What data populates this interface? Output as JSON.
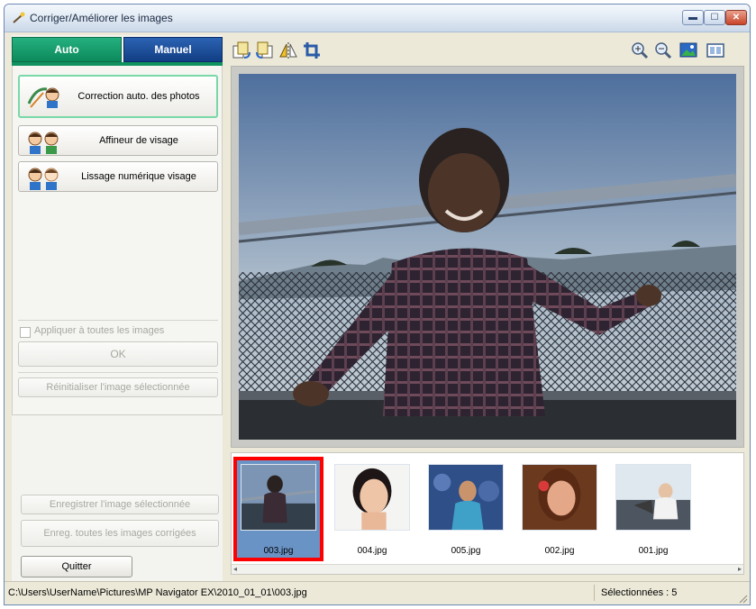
{
  "window": {
    "title": "Corriger/Améliorer les images",
    "title_icon": "wand-icon"
  },
  "tabs": [
    {
      "label": "Auto"
    },
    {
      "label": "Manuel"
    }
  ],
  "auto_panel": {
    "buttons": [
      {
        "label": "Correction auto. des photos",
        "icon": "auto-photo-correction-icon"
      },
      {
        "label": "Affineur de visage",
        "icon": "face-sharpener-icon"
      },
      {
        "label": "Lissage numérique visage",
        "icon": "digital-face-smoothing-icon"
      }
    ],
    "apply_all_label": "Appliquer à toutes les images",
    "ok_label": "OK",
    "reset_label": "Réinitialiser l'image sélectionnée"
  },
  "bottom_buttons": {
    "save_selected": "Enregistrer l'image sélectionnée",
    "save_all": "Enreg. toutes les images corrigées",
    "quit": "Quitter"
  },
  "toolbar": {
    "left": [
      "rotate-left-icon",
      "rotate-right-icon",
      "flip-horizontal-icon",
      "crop-icon"
    ],
    "right": [
      "zoom-in-icon",
      "zoom-out-icon",
      "whole-image-icon",
      "compare-icon"
    ]
  },
  "thumbnails": [
    {
      "name": "003.jpg",
      "selected": true
    },
    {
      "name": "004.jpg",
      "selected": false
    },
    {
      "name": "005.jpg",
      "selected": false
    },
    {
      "name": "002.jpg",
      "selected": false
    },
    {
      "name": "001.jpg",
      "selected": false
    }
  ],
  "status": {
    "path": "C:\\Users\\UserName\\Pictures\\MP Navigator EX\\2010_01_01\\003.jpg",
    "selected_count": "Sélectionnées : 5"
  }
}
